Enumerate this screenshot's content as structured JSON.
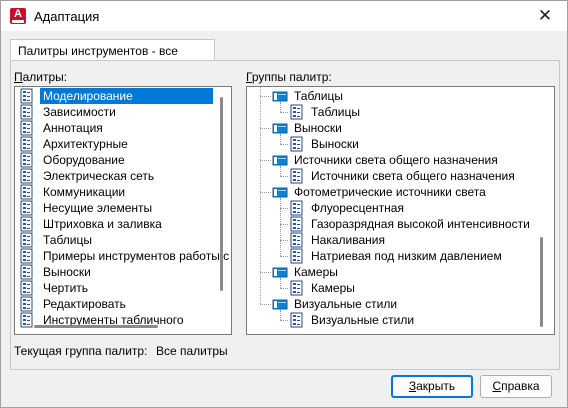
{
  "window": {
    "title": "Адаптация",
    "app_icon_letter": "A",
    "close_glyph": "✕"
  },
  "tab": {
    "label": "Палитры инструментов - все палитры"
  },
  "palettes": {
    "label_first": "П",
    "label_rest": "алитры:",
    "selected_index": 0,
    "items": [
      "Моделирование",
      "Зависимости",
      "Аннотация",
      "Архитектурные",
      "Оборудование",
      "Электрическая сеть",
      "Коммуникации",
      "Несущие элементы",
      "Штриховка и заливка",
      "Таблицы",
      "Примеры инструментов работы с",
      "Выноски",
      "Чертить",
      "Редактировать",
      "Инструменты табличного"
    ]
  },
  "groups": {
    "label_first": "Г",
    "label_rest": "руппы палитр:",
    "tree": [
      {
        "label": "Таблицы",
        "level": 0,
        "type": "group"
      },
      {
        "label": "Таблицы",
        "level": 1,
        "type": "palette"
      },
      {
        "label": "Выноски",
        "level": 0,
        "type": "group"
      },
      {
        "label": "Выноски",
        "level": 1,
        "type": "palette"
      },
      {
        "label": "Источники света общего назначения",
        "level": 0,
        "type": "group"
      },
      {
        "label": "Источники света общего назначения",
        "level": 1,
        "type": "palette"
      },
      {
        "label": "Фотометрические источники света",
        "level": 0,
        "type": "group"
      },
      {
        "label": "Флуоресцентная",
        "level": 1,
        "type": "palette"
      },
      {
        "label": "Газоразрядная высокой интенсивности",
        "level": 1,
        "type": "palette"
      },
      {
        "label": "Накаливания",
        "level": 1,
        "type": "palette"
      },
      {
        "label": "Натриевая под низким давлением",
        "level": 1,
        "type": "palette"
      },
      {
        "label": "Камеры",
        "level": 0,
        "type": "group"
      },
      {
        "label": "Камеры",
        "level": 1,
        "type": "palette"
      },
      {
        "label": "Визуальные стили",
        "level": 0,
        "type": "group"
      },
      {
        "label": "Визуальные стили",
        "level": 1,
        "type": "palette"
      }
    ]
  },
  "current_group": {
    "label": "Текущая группа палитр:",
    "value": "Все палитры"
  },
  "buttons": {
    "close_first": "З",
    "close_rest": "акрыть",
    "help_first": "С",
    "help_rest": "правка"
  },
  "colors": {
    "selection": "#0078d7",
    "app_icon": "#c8102e",
    "group_icon": "#0a84d6"
  },
  "icons": {
    "palette_item": "tool-palette-icon",
    "group_item": "palette-group-icon"
  }
}
